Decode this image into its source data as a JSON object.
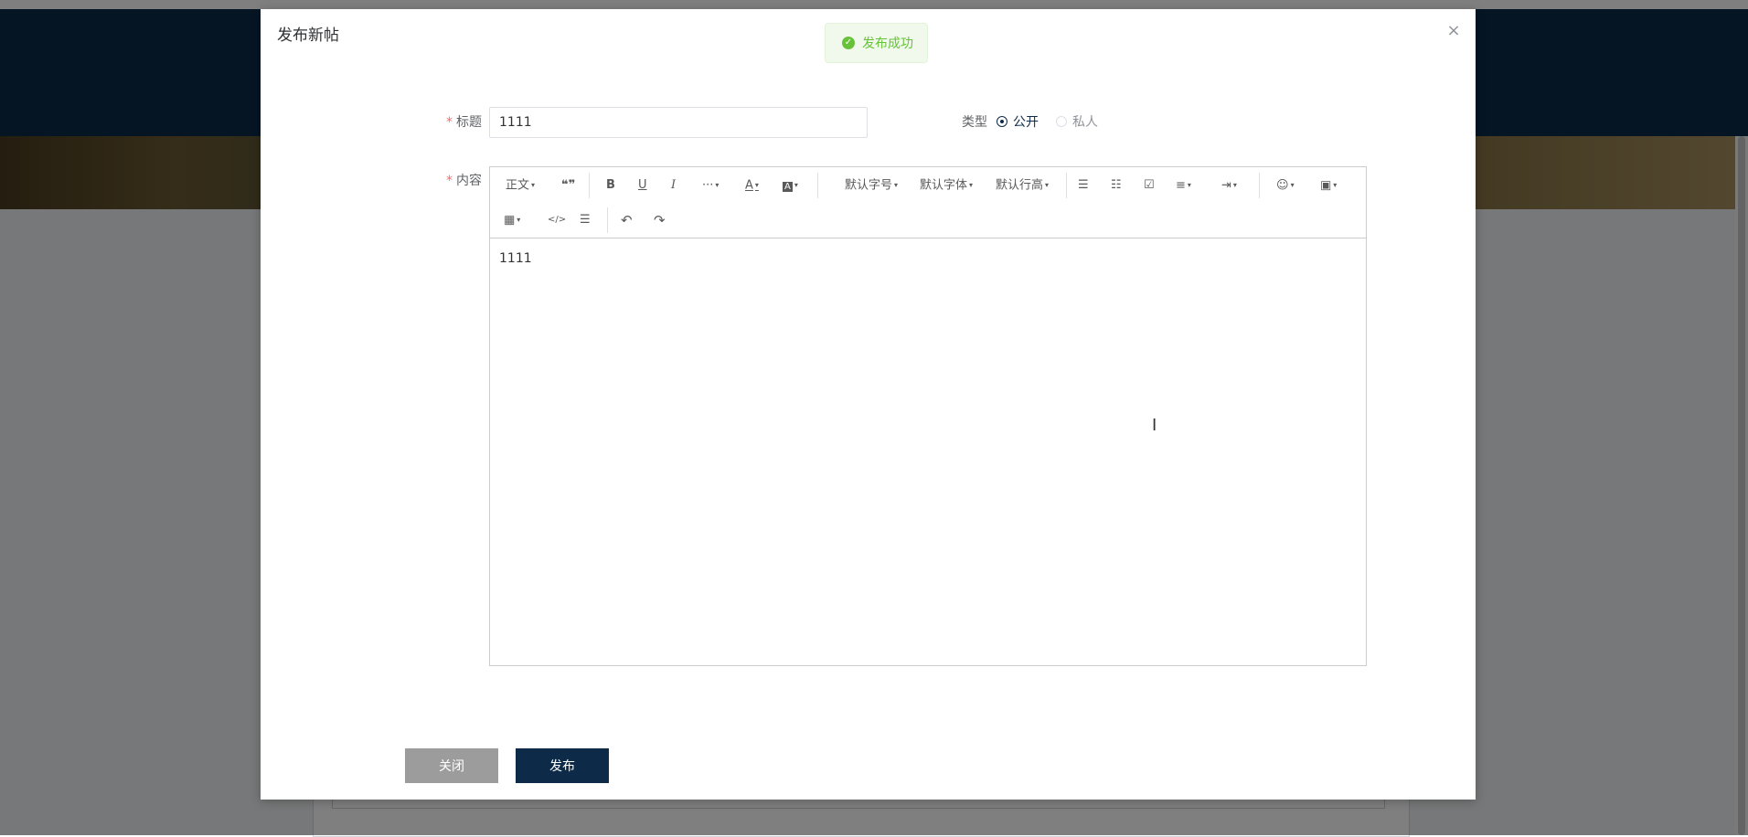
{
  "modal": {
    "title": "发布新帖",
    "close_glyph": "×"
  },
  "toast": {
    "icon": "check-circle-icon",
    "message": "发布成功",
    "color": "#67c23a"
  },
  "form": {
    "title_label": "标题",
    "title_value": "1111",
    "type_label": "类型",
    "type_options": [
      {
        "label": "公开",
        "selected": true
      },
      {
        "label": "私人",
        "selected": false
      }
    ],
    "content_label": "内容",
    "content_value": "1111"
  },
  "toolbar": {
    "row1": [
      {
        "name": "paragraph-dropdown",
        "label": "正文",
        "caret": true
      },
      {
        "name": "quote-icon",
        "label": "❝❞",
        "caret": false
      },
      {
        "name": "bold-icon",
        "label": "B",
        "caret": false
      },
      {
        "name": "underline-icon",
        "label": "U",
        "caret": false
      },
      {
        "name": "italic-icon",
        "label": "I",
        "caret": false
      },
      {
        "name": "more-icon",
        "label": "···",
        "caret": true
      },
      {
        "name": "font-color-icon",
        "label": "A",
        "caret": true
      },
      {
        "name": "bg-color-icon",
        "label": "A",
        "caret": true
      },
      {
        "name": "font-size-dropdown",
        "label": "默认字号",
        "caret": true
      },
      {
        "name": "font-family-dropdown",
        "label": "默认字体",
        "caret": true
      },
      {
        "name": "line-height-dropdown",
        "label": "默认行高",
        "caret": true
      },
      {
        "name": "bulleted-list-icon",
        "label": "☰",
        "caret": false
      },
      {
        "name": "numbered-list-icon",
        "label": "☷",
        "caret": false
      },
      {
        "name": "todo-icon",
        "label": "☑",
        "caret": false
      },
      {
        "name": "align-icon",
        "label": "≡",
        "caret": true
      },
      {
        "name": "indent-icon",
        "label": "⇥",
        "caret": true
      },
      {
        "name": "emoji-icon",
        "label": "☺",
        "caret": true
      },
      {
        "name": "image-icon",
        "label": "▣",
        "caret": true
      }
    ],
    "row2": [
      {
        "name": "table-icon",
        "label": "▦",
        "caret": true
      },
      {
        "name": "code-icon",
        "label": "</>",
        "caret": false
      },
      {
        "name": "divider-icon",
        "label": "☰",
        "caret": false
      },
      {
        "name": "undo-icon",
        "label": "↶",
        "caret": false
      },
      {
        "name": "redo-icon",
        "label": "↷",
        "caret": false
      }
    ]
  },
  "footer": {
    "close_label": "关闭",
    "publish_label": "发布"
  },
  "colors": {
    "primary": "#0d2b48",
    "required": "#f56c6c",
    "success": "#67c23a"
  }
}
